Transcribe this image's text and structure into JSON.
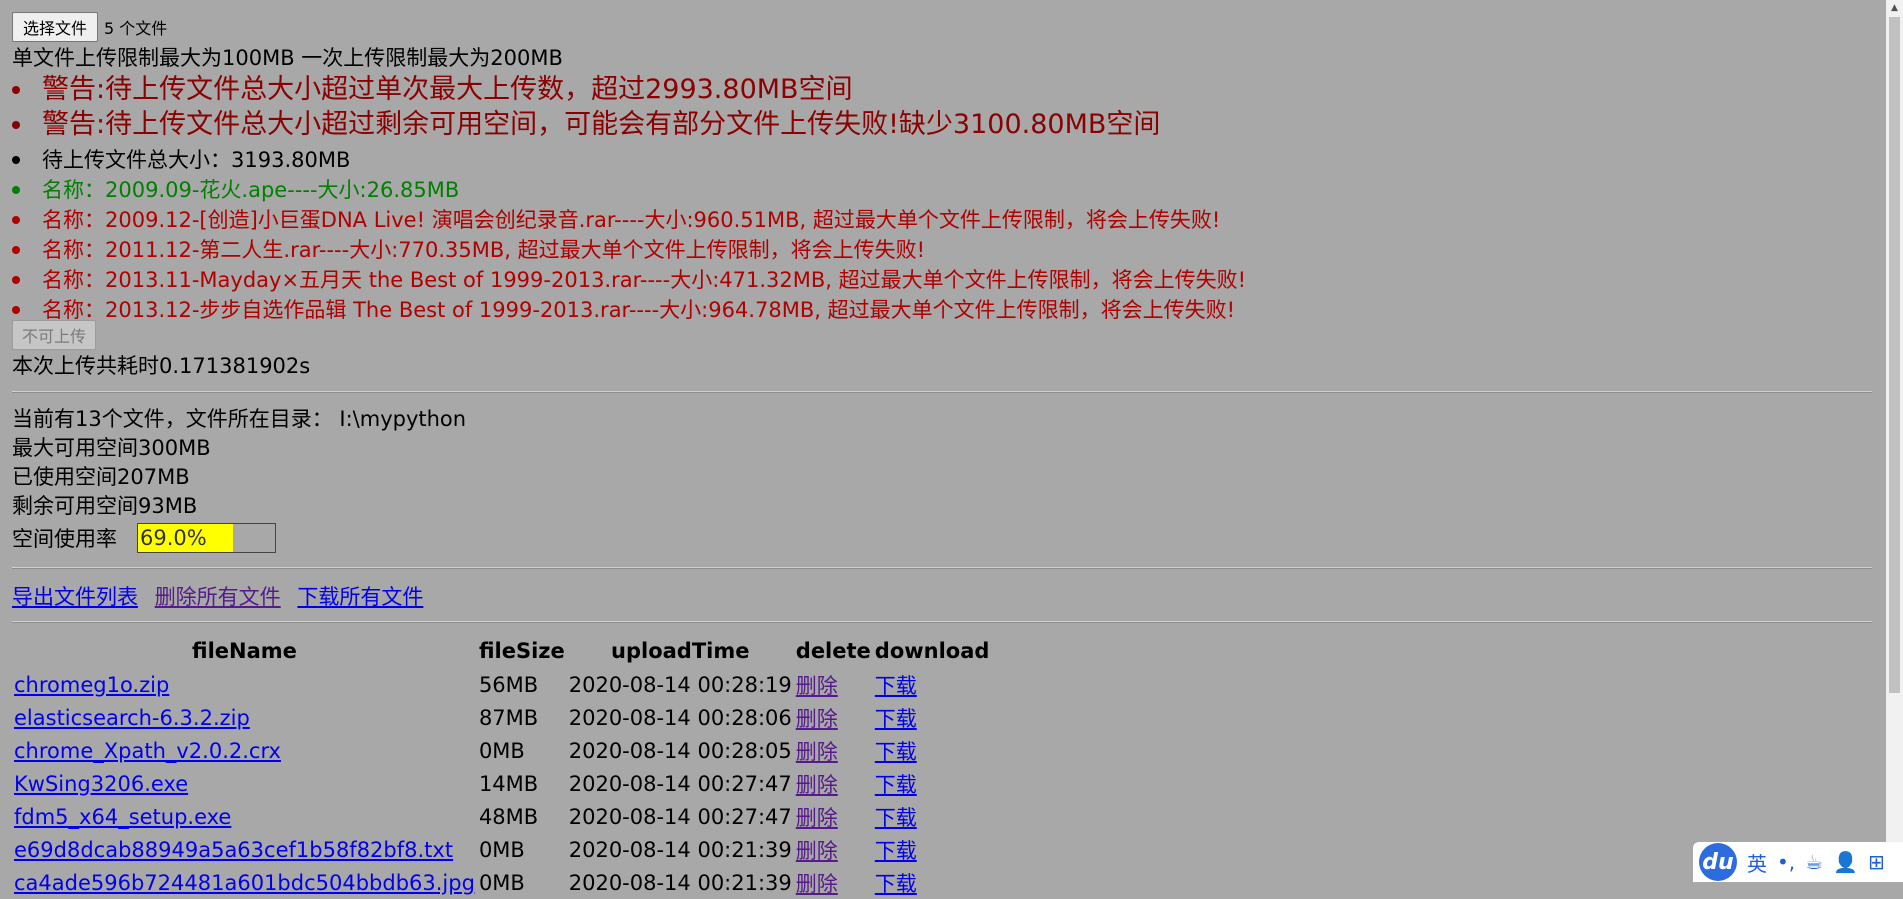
{
  "upload": {
    "choose_label": "选择文件",
    "file_count": "5 个文件",
    "limit_text": "单文件上传限制最大为100MB 一次上传限制最大为200MB",
    "warnings": [
      "警告:待上传文件总大小超过单次最大上传数，超过2993.80MB空间",
      "警告:待上传文件总大小超过剩余可用空间，可能会有部分文件上传失败!缺少3100.80MB空间"
    ],
    "total_size": "待上传文件总大小：3193.80MB",
    "files": [
      {
        "text": "名称：2009.09-花火.ape----大小:26.85MB",
        "status": "ok"
      },
      {
        "text": "名称：2009.12-[创造]小巨蛋DNA Live! 演唱会创纪录音.rar----大小:960.51MB, 超过最大单个文件上传限制，将会上传失败!",
        "status": "error"
      },
      {
        "text": "名称：2011.12-第二人生.rar----大小:770.35MB, 超过最大单个文件上传限制，将会上传失败!",
        "status": "error"
      },
      {
        "text": "名称：2013.11-Mayday×五月天 the Best of 1999-2013.rar----大小:471.32MB, 超过最大单个文件上传限制，将会上传失败!",
        "status": "error"
      },
      {
        "text": "名称：2013.12-步步自选作品辑 The Best of 1999-2013.rar----大小:964.78MB, 超过最大单个文件上传限制，将会上传失败!",
        "status": "error"
      }
    ],
    "submit_label": "不可上传",
    "elapsed": "本次上传共耗时0.171381902s"
  },
  "storage": {
    "current": "当前有13个文件，文件所在目录： I:\\mypython",
    "max_space": "最大可用空间300MB",
    "used_space": "已使用空间207MB",
    "free_space": "剩余可用空间93MB",
    "usage_label": "空间使用率",
    "usage_text": "69.0%",
    "usage_fraction": 0.69
  },
  "actions": {
    "export": "导出文件列表",
    "delete_all": "删除所有文件",
    "download_all": "下载所有文件"
  },
  "table": {
    "headers": [
      "fileName",
      "fileSize",
      "uploadTime",
      "delete",
      "download"
    ],
    "delete_label": "删除",
    "download_label": "下载",
    "rows": [
      {
        "name": "chromeg1o.zip",
        "size": "56MB",
        "time": "2020-08-14 00:28:19"
      },
      {
        "name": "elasticsearch-6.3.2.zip",
        "size": "87MB",
        "time": "2020-08-14 00:28:06"
      },
      {
        "name": "chrome_Xpath_v2.0.2.crx",
        "size": "0MB",
        "time": "2020-08-14 00:28:05"
      },
      {
        "name": "KwSing3206.exe",
        "size": "14MB",
        "time": "2020-08-14 00:27:47"
      },
      {
        "name": "fdm5_x64_setup.exe",
        "size": "48MB",
        "time": "2020-08-14 00:27:47"
      },
      {
        "name": "e69d8dcab88949a5a63cef1b58f82bf8.txt",
        "size": "0MB",
        "time": "2020-08-14 00:21:39"
      },
      {
        "name": "ca4ade596b724481a601bdc504bbdb63.jpg",
        "size": "0MB",
        "time": "2020-08-14 00:21:39"
      }
    ]
  },
  "ime": {
    "logo": "du",
    "lang": "英",
    "punct": "•,",
    "cup": "☕",
    "user": "👤",
    "grid": "⊞"
  },
  "colors": {
    "background": "#a8a8a8",
    "warning": "#8b0000",
    "error": "#b00000",
    "ok": "#008000",
    "link": "#0000ee",
    "visited_link": "#551a8b",
    "usage_fill": "#ffff00"
  }
}
